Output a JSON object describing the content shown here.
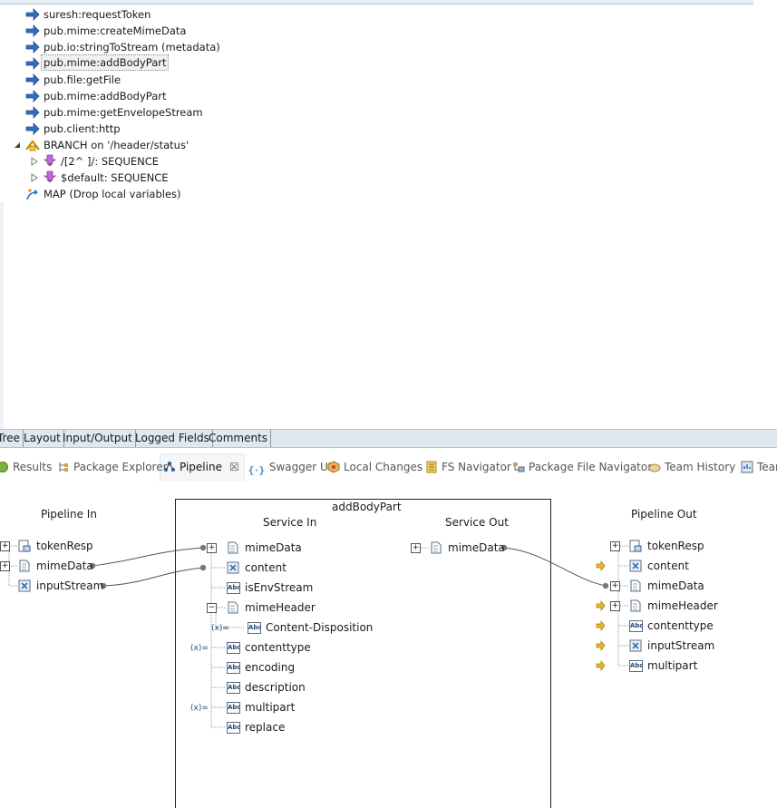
{
  "flow_tree": {
    "steps": [
      {
        "label": "suresh:requestToken",
        "icon": "invoke-arrow-icon"
      },
      {
        "label": "pub.mime:createMimeData",
        "icon": "invoke-arrow-icon"
      },
      {
        "label": "pub.io:stringToStream (metadata)",
        "icon": "invoke-arrow-icon"
      },
      {
        "label": "pub.mime:addBodyPart",
        "icon": "invoke-arrow-icon",
        "selected": true
      },
      {
        "label": "pub.file:getFile",
        "icon": "invoke-arrow-icon"
      },
      {
        "label": "pub.mime:addBodyPart",
        "icon": "invoke-arrow-icon"
      },
      {
        "label": "pub.mime:getEnvelopeStream",
        "icon": "invoke-arrow-icon"
      },
      {
        "label": "pub.client:http",
        "icon": "invoke-arrow-icon"
      },
      {
        "label": "BRANCH on '/header/status'",
        "icon": "branch-icon"
      },
      {
        "label": "/[2^ ]/: SEQUENCE",
        "icon": "sequence-icon"
      },
      {
        "label": "$default: SEQUENCE",
        "icon": "sequence-icon"
      },
      {
        "label": "MAP (Drop local variables)",
        "icon": "map-icon"
      }
    ]
  },
  "editor_tabs": [
    "Tree",
    "Layout",
    "Input/Output",
    "Logged Fields",
    "Comments"
  ],
  "view_tabs": [
    {
      "label": "Results",
      "icon": "results-icon"
    },
    {
      "label": "Package Explorer",
      "icon": "package-explorer-icon"
    },
    {
      "label": "Pipeline",
      "icon": "pipeline-icon",
      "active": true
    },
    {
      "label": "Swagger UI",
      "icon": "swagger-icon"
    },
    {
      "label": "Local Changes",
      "icon": "local-changes-icon"
    },
    {
      "label": "FS Navigator",
      "icon": "fs-navigator-icon"
    },
    {
      "label": "Package File Navigator",
      "icon": "package-file-navigator-icon"
    },
    {
      "label": "Team History",
      "icon": "team-history-icon"
    },
    {
      "label": "Tean",
      "icon": "team-icon"
    }
  ],
  "pipeline": {
    "pipeline_in_title": "Pipeline In",
    "service_name": "addBodyPart",
    "service_in_title": "Service In",
    "service_out_title": "Service Out",
    "pipeline_out_title": "Pipeline Out",
    "pipeline_in": [
      {
        "label": "tokenResp",
        "type": "record-icon"
      },
      {
        "label": "mimeData",
        "type": "document-icon"
      },
      {
        "label": "inputStream",
        "type": "object-icon"
      }
    ],
    "service_in": [
      {
        "label": "mimeData",
        "type": "document-icon"
      },
      {
        "label": "content",
        "type": "object-icon"
      },
      {
        "label": "isEnvStream",
        "type": "string-icon"
      },
      {
        "label": "mimeHeader",
        "type": "document-icon"
      },
      {
        "label": "Content-Disposition",
        "type": "string-icon"
      },
      {
        "label": "contenttype",
        "type": "string-icon"
      },
      {
        "label": "encoding",
        "type": "string-icon"
      },
      {
        "label": "description",
        "type": "string-icon"
      },
      {
        "label": "multipart",
        "type": "string-icon"
      },
      {
        "label": "replace",
        "type": "string-icon"
      }
    ],
    "service_out": [
      {
        "label": "mimeData",
        "type": "document-icon"
      }
    ],
    "pipeline_out": [
      {
        "label": "tokenResp",
        "type": "record-icon"
      },
      {
        "label": "content",
        "type": "object-icon"
      },
      {
        "label": "mimeData",
        "type": "document-icon"
      },
      {
        "label": "mimeHeader",
        "type": "document-icon"
      },
      {
        "label": "contenttype",
        "type": "string-icon"
      },
      {
        "label": "inputStream",
        "type": "object-icon"
      },
      {
        "label": "multipart",
        "type": "string-icon"
      }
    ],
    "set_value_marker": "(x)=",
    "abc_glyph": "Abc"
  }
}
